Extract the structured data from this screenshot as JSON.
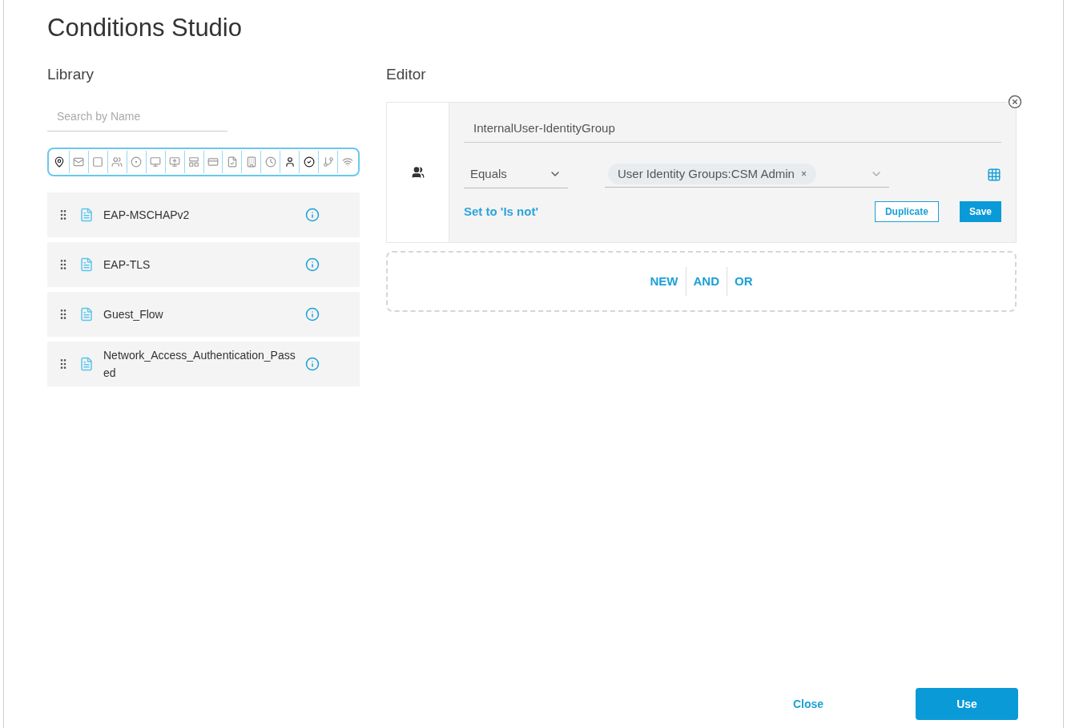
{
  "title": "Conditions Studio",
  "library": {
    "heading": "Library",
    "search": {
      "placeholder": "Search by Name"
    },
    "items": [
      {
        "name": "EAP-MSCHAPv2"
      },
      {
        "name": "EAP-TLS"
      },
      {
        "name": "Guest_Flow"
      },
      {
        "name": "Network_Access_Authentication_Passed"
      }
    ]
  },
  "editor": {
    "heading": "Editor",
    "attribute": "InternalUser-IdentityGroup",
    "operator": "Equals",
    "value_tag": "User Identity Groups:CSM Admin",
    "tag_remove": "×",
    "negate_link": "Set to 'Is not'",
    "buttons": [
      {
        "label": "Duplicate",
        "kind": "outline"
      },
      {
        "label": "Save",
        "kind": "primary"
      }
    ],
    "add_actions": [
      "NEW",
      "AND",
      "OR"
    ]
  },
  "footer": {
    "buttons": [
      {
        "label": "Close",
        "kind": "link"
      },
      {
        "label": "Use",
        "kind": "primary"
      }
    ]
  }
}
